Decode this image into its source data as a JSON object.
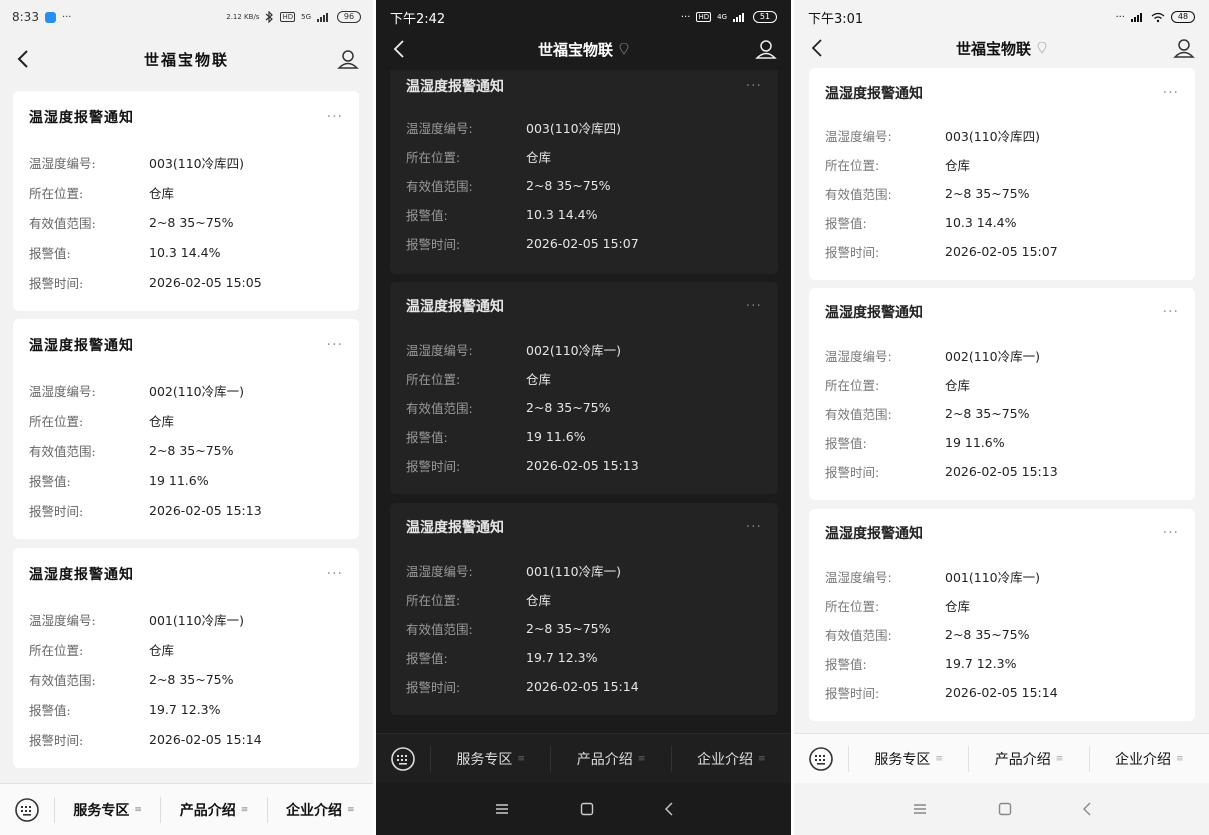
{
  "app_title": "世福宝物联",
  "panels": [
    {
      "status": {
        "time": "8:33",
        "left_extra": "···",
        "net_speed": "2.12 KB/s",
        "signal": "5G",
        "battery": "96"
      },
      "cards": [
        {
          "title": "温湿度报警通知",
          "rows": [
            {
              "label": "温湿度编号:",
              "value": "003(110冷库四)"
            },
            {
              "label": "所在位置:",
              "value": "仓库"
            },
            {
              "label": "有效值范围:",
              "value": "2~8 35~75%"
            },
            {
              "label": "报警值:",
              "value": "10.3   14.4%"
            },
            {
              "label": "报警时间:",
              "value": "2026-02-05  15:05"
            }
          ]
        },
        {
          "title": "温湿度报警通知",
          "rows": [
            {
              "label": "温湿度编号:",
              "value": "002(110冷库一)"
            },
            {
              "label": "所在位置:",
              "value": "仓库"
            },
            {
              "label": "有效值范围:",
              "value": "2~8 35~75%"
            },
            {
              "label": "报警值:",
              "value": "19   11.6%"
            },
            {
              "label": "报警时间:",
              "value": "2026-02-05  15:13"
            }
          ]
        },
        {
          "title": "温湿度报警通知",
          "rows": [
            {
              "label": "温湿度编号:",
              "value": "001(110冷库一)"
            },
            {
              "label": "所在位置:",
              "value": "仓库"
            },
            {
              "label": "有效值范围:",
              "value": "2~8 35~75%"
            },
            {
              "label": "报警值:",
              "value": "19.7   12.3%"
            },
            {
              "label": "报警时间:",
              "value": "2026-02-05  15:14"
            }
          ]
        }
      ]
    },
    {
      "status": {
        "time": "下午2:42",
        "signal": "4G",
        "battery": "51"
      },
      "cards": [
        {
          "title": "温湿度报警通知",
          "rows": [
            {
              "label": "温湿度编号:",
              "value": "003(110冷库四)"
            },
            {
              "label": "所在位置:",
              "value": "仓库"
            },
            {
              "label": "有效值范围:",
              "value": "2~8 35~75%"
            },
            {
              "label": "报警值:",
              "value": "10.3  14.4%"
            },
            {
              "label": "报警时间:",
              "value": "2026-02-05 15:07"
            }
          ]
        },
        {
          "title": "温湿度报警通知",
          "rows": [
            {
              "label": "温湿度编号:",
              "value": "002(110冷库一)"
            },
            {
              "label": "所在位置:",
              "value": "仓库"
            },
            {
              "label": "有效值范围:",
              "value": "2~8 35~75%"
            },
            {
              "label": "报警值:",
              "value": "19  11.6%"
            },
            {
              "label": "报警时间:",
              "value": "2026-02-05 15:13"
            }
          ]
        },
        {
          "title": "温湿度报警通知",
          "rows": [
            {
              "label": "温湿度编号:",
              "value": "001(110冷库一)"
            },
            {
              "label": "所在位置:",
              "value": "仓库"
            },
            {
              "label": "有效值范围:",
              "value": "2~8 35~75%"
            },
            {
              "label": "报警值:",
              "value": "19.7  12.3%"
            },
            {
              "label": "报警时间:",
              "value": "2026-02-05 15:14"
            }
          ]
        }
      ]
    },
    {
      "status": {
        "time": "下午3:01",
        "battery": "48"
      },
      "cards": [
        {
          "title": "温湿度报警通知",
          "rows": [
            {
              "label": "温湿度编号:",
              "value": "003(110冷库四)"
            },
            {
              "label": "所在位置:",
              "value": "仓库"
            },
            {
              "label": "有效值范围:",
              "value": "2~8 35~75%"
            },
            {
              "label": "报警值:",
              "value": "10.3  14.4%"
            },
            {
              "label": "报警时间:",
              "value": "2026-02-05 15:07"
            }
          ]
        },
        {
          "title": "温湿度报警通知",
          "rows": [
            {
              "label": "温湿度编号:",
              "value": "002(110冷库一)"
            },
            {
              "label": "所在位置:",
              "value": "仓库"
            },
            {
              "label": "有效值范围:",
              "value": "2~8 35~75%"
            },
            {
              "label": "报警值:",
              "value": "19  11.6%"
            },
            {
              "label": "报警时间:",
              "value": "2026-02-05 15:13"
            }
          ]
        },
        {
          "title": "温湿度报警通知",
          "rows": [
            {
              "label": "温湿度编号:",
              "value": "001(110冷库一)"
            },
            {
              "label": "所在位置:",
              "value": "仓库"
            },
            {
              "label": "有效值范围:",
              "value": "2~8 35~75%"
            },
            {
              "label": "报警值:",
              "value": "19.7  12.3%"
            },
            {
              "label": "报警时间:",
              "value": "2026-02-05 15:14"
            }
          ]
        }
      ]
    }
  ],
  "menu": {
    "kbd_icon": "keyboard-icon",
    "tabs": [
      "服务专区",
      "产品介绍",
      "企业介绍"
    ],
    "tab_indicator": "≡"
  },
  "sysnav": {
    "menu": "≡",
    "home": "□",
    "back": "‹"
  },
  "more": "···",
  "colors": {
    "dark_bg": "#1b1b1b",
    "dark_card": "#232323",
    "light_bg": "#f3f3f3",
    "card": "#ffffff",
    "app_icon": "#2a8ef0"
  }
}
